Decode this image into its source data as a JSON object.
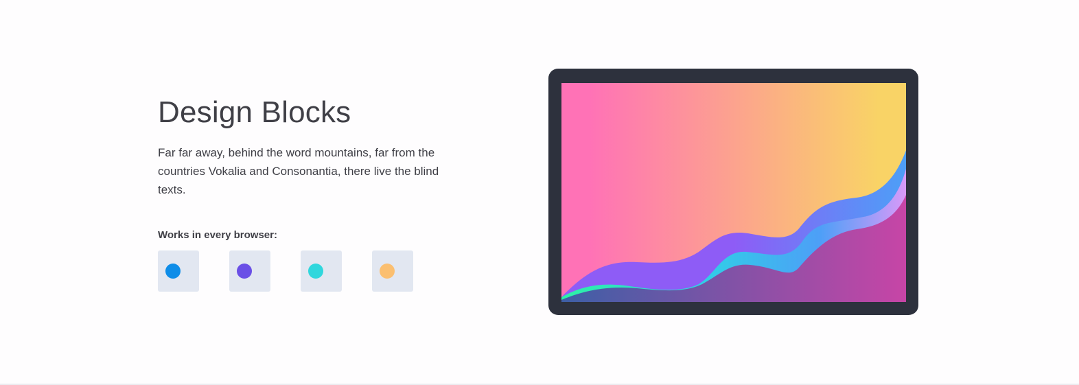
{
  "hero": {
    "title": "Design Blocks",
    "description": "Far far away, behind the word mountains, far from the countries Vokalia and Consonantia, there live the blind texts."
  },
  "browsers": {
    "label": "Works in every browser:",
    "items": [
      {
        "icon": "chrome-icon",
        "color": "#0e8de8"
      },
      {
        "icon": "firefox-icon",
        "color": "#6a4fe6"
      },
      {
        "icon": "edge-icon",
        "color": "#30d7dd"
      },
      {
        "icon": "safari-icon",
        "color": "#fbbf70"
      }
    ]
  },
  "illustration": {
    "icon": "abstract-waves-illustration",
    "colors": {
      "frame": "#2d313d",
      "sky_left": "#ff72b6",
      "sky_right": "#f9d366",
      "wave_blue": "#4d9ff7",
      "wave_violet": "#8e5cf6",
      "wave_cyan": "#2fd1e6",
      "wave_green": "#2df0a8",
      "base_left": "#3d5fa6",
      "base_right": "#c745a6"
    }
  }
}
